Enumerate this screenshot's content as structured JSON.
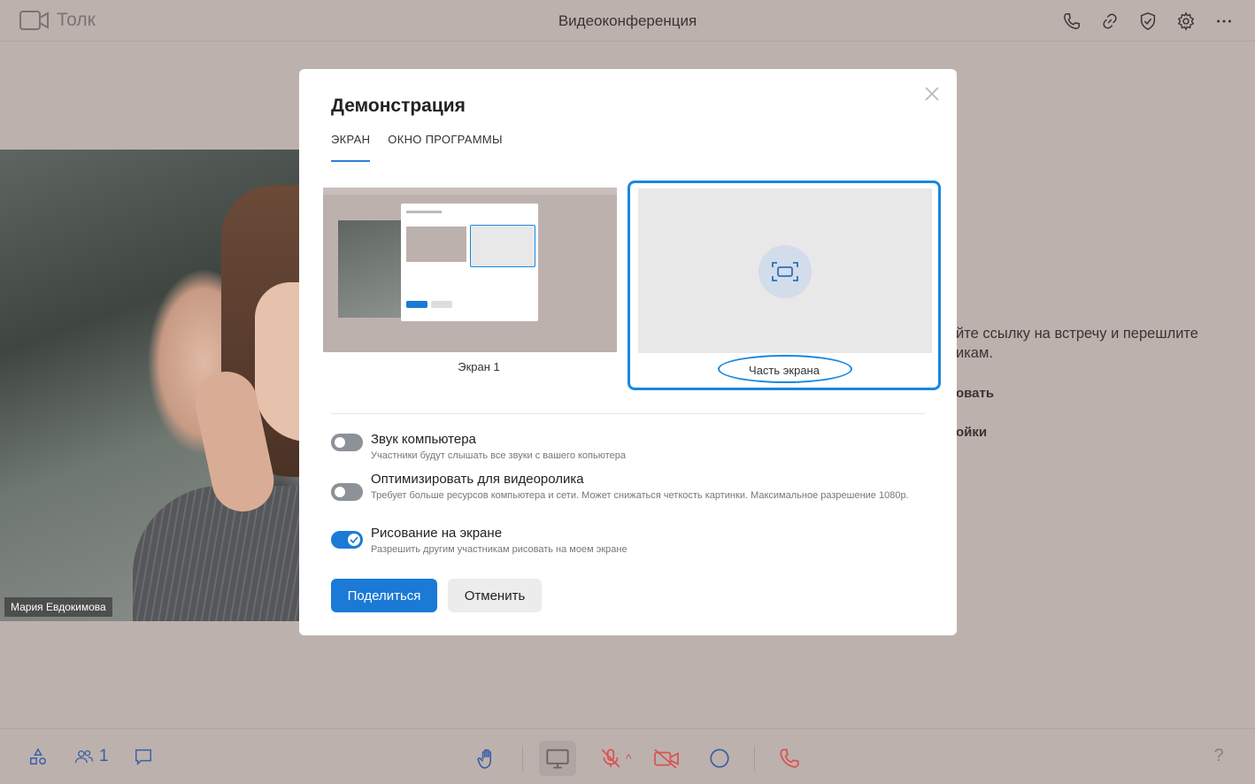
{
  "app": {
    "logo_text": "Толк",
    "title": "Видеоконференция"
  },
  "top_icons": [
    "phone-icon",
    "link-icon",
    "shield-check-icon",
    "gear-icon",
    "more-icon"
  ],
  "participant": {
    "name": "Мария Евдокимова"
  },
  "side_text": {
    "line1": "йте ссылку на встречу и перешлите",
    "line2": "икам.",
    "line3": "овать",
    "line4": "ойки"
  },
  "bottom": {
    "participants_count": "1",
    "help": "?"
  },
  "modal": {
    "title": "Демонстрация",
    "tabs": [
      {
        "label": "ЭКРАН"
      },
      {
        "label": "ОКНО ПРОГРАММЫ"
      }
    ],
    "options": [
      {
        "label": "Экран 1"
      },
      {
        "label": "Часть экрана"
      }
    ],
    "settings": [
      {
        "title": "Звук компьютера",
        "desc": "Участники будут слышать все звуки с вашего копьютера",
        "on": false
      },
      {
        "title": "Оптимизировать для видеоролика",
        "desc": "Требует больше ресурсов компьютера и сети. Может снижаться четкость картинки. Максимальное разрешение 1080р.",
        "on": false
      },
      {
        "title": "Рисование на экране",
        "desc": "Разрешить другим участникам рисовать на моем экране",
        "on": true
      }
    ],
    "share_label": "Поделиться",
    "cancel_label": "Отменить"
  },
  "colors": {
    "accent": "#1a7ad6",
    "background": "#bdb1ae",
    "danger": "#d9534f"
  }
}
